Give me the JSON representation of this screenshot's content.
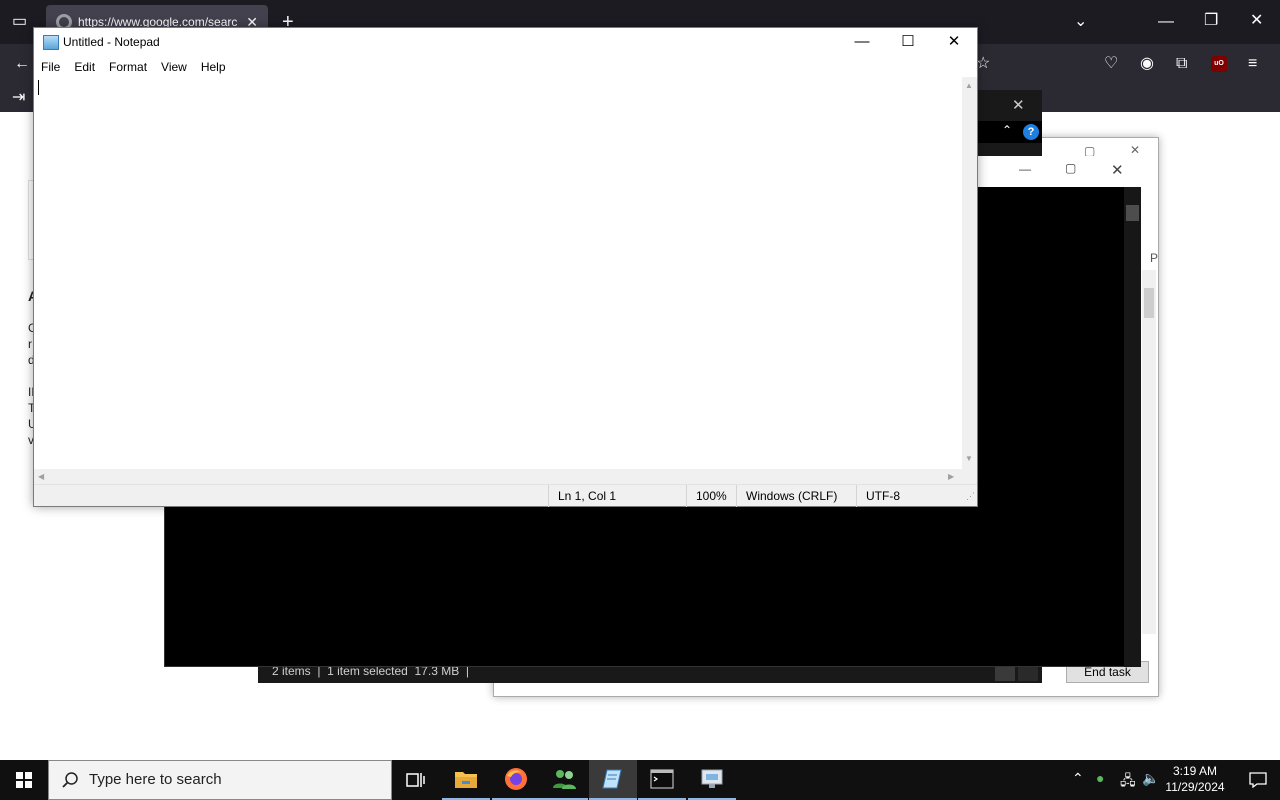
{
  "browser": {
    "tab_url": "https://www.google.com/searc",
    "tab_close": "✕",
    "new_tab": "+",
    "page_letters": [
      "A",
      "G",
      "r",
      "d",
      "IF",
      "T",
      "U",
      "v"
    ]
  },
  "explorer": {
    "status": "2 items  |  1 item selected  17.3 MB  |",
    "help": "?"
  },
  "taskmgr": {
    "end_task": "End task",
    "partial_label": "P"
  },
  "notepad": {
    "title": "Untitled - Notepad",
    "menu": [
      "File",
      "Edit",
      "Format",
      "View",
      "Help"
    ],
    "content": "",
    "status": {
      "position": "Ln 1, Col 1",
      "zoom": "100%",
      "line_ending": "Windows (CRLF)",
      "encoding": "UTF-8"
    }
  },
  "taskbar": {
    "search_placeholder": "Type here to search",
    "time": "3:19 AM",
    "date": "11/29/2024",
    "apps": [
      "task-view",
      "file-explorer",
      "firefox",
      "people-app",
      "notepad",
      "terminal",
      "remote-desktop"
    ]
  }
}
